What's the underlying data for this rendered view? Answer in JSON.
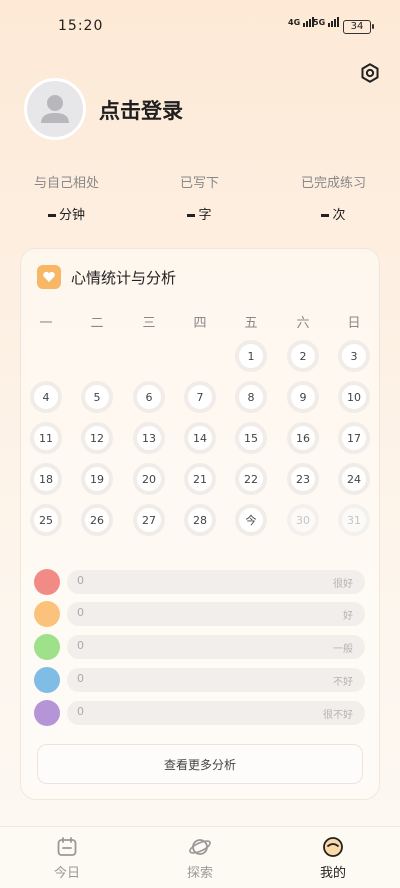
{
  "status_bar": {
    "time": "15:20",
    "net1": "4G",
    "net2": "5G",
    "battery": "34"
  },
  "profile": {
    "login_text": "点击登录"
  },
  "stats": [
    {
      "label": "与自己相处",
      "unit": "分钟"
    },
    {
      "label": "已写下",
      "unit": "字"
    },
    {
      "label": "已完成练习",
      "unit": "次"
    }
  ],
  "mood_card": {
    "title": "心情统计与分析",
    "weekdays": [
      "一",
      "二",
      "三",
      "四",
      "五",
      "六",
      "日"
    ],
    "days_row1": [
      "1",
      "2",
      "3"
    ],
    "days_row2": [
      "4",
      "5",
      "6",
      "7",
      "8",
      "9",
      "10"
    ],
    "days_row3": [
      "11",
      "12",
      "13",
      "14",
      "15",
      "16",
      "17"
    ],
    "days_row4": [
      "18",
      "19",
      "20",
      "21",
      "22",
      "23",
      "24"
    ],
    "days_row5": [
      "25",
      "26",
      "27",
      "28",
      "今",
      "30",
      "31"
    ],
    "moods": [
      {
        "label": "很好",
        "count": "0",
        "color": "#f28b86"
      },
      {
        "label": "好",
        "count": "0",
        "color": "#fbc27c"
      },
      {
        "label": "一般",
        "count": "0",
        "color": "#9fe08a"
      },
      {
        "label": "不好",
        "count": "0",
        "color": "#7fbde6"
      },
      {
        "label": "很不好",
        "count": "0",
        "color": "#b595d8"
      }
    ],
    "more_button": "查看更多分析"
  },
  "tabs": [
    {
      "label": "今日",
      "icon": "calendar-icon"
    },
    {
      "label": "探索",
      "icon": "planet-icon"
    },
    {
      "label": "我的",
      "icon": "face-icon",
      "active": true
    }
  ]
}
